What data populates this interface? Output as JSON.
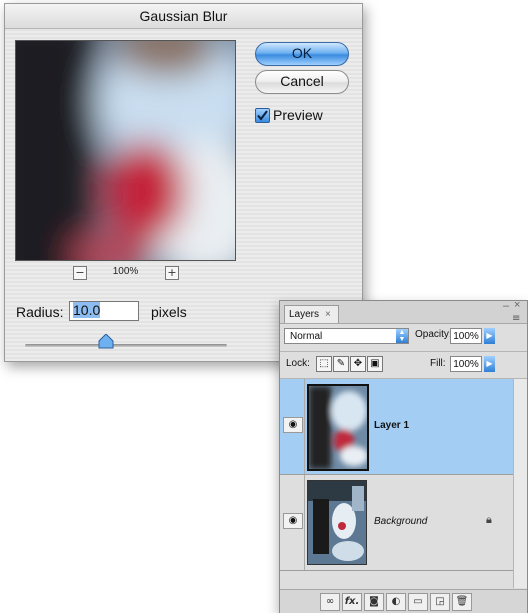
{
  "gaussian_blur": {
    "title": "Gaussian Blur",
    "ok_label": "OK",
    "cancel_label": "Cancel",
    "preview_label": "Preview",
    "preview_checked": true,
    "zoom_out": "−",
    "zoom_level": "100%",
    "zoom_in": "+",
    "radius_label": "Radius:",
    "radius_value": "10.0",
    "units_label": "pixels",
    "slider_icon": "slider-thumb-icon"
  },
  "layers_panel": {
    "tab_label": "Layers",
    "tab_close": "×",
    "minimize": "–",
    "close": "×",
    "menu": "≡",
    "blend_mode": "Normal",
    "opacity_label": "Opacity:",
    "opacity_value": "100%",
    "lock_label": "Lock:",
    "fill_label": "Fill:",
    "fill_value": "100%",
    "layers": [
      {
        "name": "Layer 1",
        "selected": true,
        "visible": true
      },
      {
        "name": "Background",
        "selected": false,
        "visible": true,
        "locked": true
      }
    ],
    "footer_icons": [
      "link-icon",
      "fx-icon",
      "mask-icon",
      "adjustment-icon",
      "group-folder-icon",
      "new-layer-icon",
      "trash-icon"
    ],
    "fx_label": "fx."
  },
  "colors": {
    "accent_blue": "#3a8be0",
    "selected_layer": "#a3cdf2"
  }
}
